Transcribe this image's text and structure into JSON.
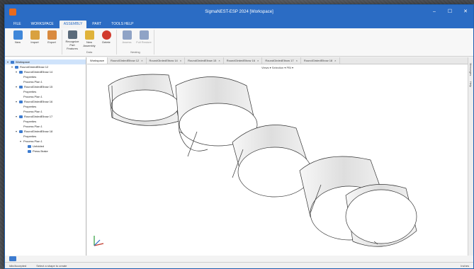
{
  "window": {
    "title": "SigmaNEST-ESP 2024 [Workspace]",
    "controls": [
      "–",
      "☐",
      "✕"
    ]
  },
  "menu": [
    "FILE",
    "WORKSPACE",
    "ASSEMBLY",
    "PART",
    "TOOLS HELP"
  ],
  "ribbon": {
    "groups": [
      {
        "name": "",
        "buttons": [
          {
            "label": "New",
            "color": "#3f87d9"
          },
          {
            "label": "Import",
            "color": "#d9a13f"
          },
          {
            "label": "Export",
            "color": "#d98a3f"
          }
        ]
      },
      {
        "name": "Data",
        "buttons": [
          {
            "label": "Recognize Part Features",
            "color": "#5b6b7b"
          },
          {
            "label": "New Assembly",
            "color": "#e0b33a"
          },
          {
            "label": "Delete",
            "color": "#d13b2e"
          }
        ]
      },
      {
        "name": "Nesting",
        "buttons": [
          {
            "label": "Assess",
            "color": "#8fa3c6",
            "disabled": true
          },
          {
            "label": "Full Restore",
            "color": "#8fa3c6",
            "disabled": true
          }
        ]
      }
    ]
  },
  "tabs": [
    "Workspace",
    "RoundGirdedElbow 12",
    "RoundGirdedElbow 14",
    "RoundGirdedElbow 15",
    "RoundGirdedElbow 16",
    "RoundGirdedElbow 17",
    "RoundGirdedElbow 18"
  ],
  "tree": [
    {
      "label": "Workspace",
      "level": 0,
      "exp": "▾",
      "icon": "#3c7bd0",
      "sel": true
    },
    {
      "label": "RoundGirdedElbow 12",
      "level": 1,
      "exp": "▾",
      "icon": "#3c7bd0"
    },
    {
      "label": "RoundGirdedElbow 14",
      "level": 2,
      "exp": "▾",
      "icon": "#3c7bd0"
    },
    {
      "label": "Properties",
      "level": 3,
      "exp": "",
      "icon": ""
    },
    {
      "label": "Process Plan 1",
      "level": 3,
      "exp": "",
      "icon": ""
    },
    {
      "label": "RoundGirdedElbow 15",
      "level": 2,
      "exp": "▾",
      "icon": "#3c7bd0"
    },
    {
      "label": "Properties",
      "level": 3,
      "exp": "",
      "icon": ""
    },
    {
      "label": "Process Plan 1",
      "level": 3,
      "exp": "",
      "icon": ""
    },
    {
      "label": "RoundGirdedElbow 16",
      "level": 2,
      "exp": "▾",
      "icon": "#3c7bd0"
    },
    {
      "label": "Properties",
      "level": 3,
      "exp": "",
      "icon": ""
    },
    {
      "label": "Process Plan 1",
      "level": 3,
      "exp": "",
      "icon": ""
    },
    {
      "label": "RoundGirdedElbow 17",
      "level": 2,
      "exp": "▾",
      "icon": "#3c7bd0"
    },
    {
      "label": "Properties",
      "level": 3,
      "exp": "",
      "icon": ""
    },
    {
      "label": "Process Plan 1",
      "level": 3,
      "exp": "",
      "icon": ""
    },
    {
      "label": "RoundGirdedElbow 18",
      "level": 2,
      "exp": "▾",
      "icon": "#3c7bd0"
    },
    {
      "label": "Properties",
      "level": 3,
      "exp": "",
      "icon": ""
    },
    {
      "label": "Process Plan 1",
      "level": 3,
      "exp": "▾",
      "icon": ""
    },
    {
      "label": "Unfolded",
      "level": 4,
      "exp": "",
      "icon": "#3c7bd0"
    },
    {
      "label": "Press Brake",
      "level": 4,
      "exp": "",
      "icon": "#3c7bd0"
    }
  ],
  "viewbar": "Views ▾  Selection ▾  PBI ▾",
  "sidestrip": [
    "Messages",
    "Help"
  ],
  "status": {
    "left": "Idle/Accepted",
    "hint": "Select a shape to create",
    "right": "Inches"
  },
  "colors": {
    "accent": "#2b6cc4",
    "selection": "#cfe3fb"
  }
}
